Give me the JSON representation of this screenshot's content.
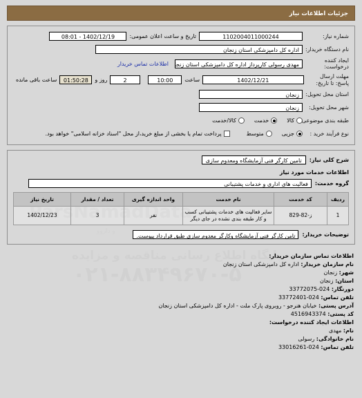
{
  "header": {
    "title": "جزئیات اطلاعات نیاز"
  },
  "form": {
    "need_number_label": "شماره نیاز:",
    "need_number_value": "1102004011000244",
    "announce_datetime_label": "تاریخ و ساعت اعلان عمومی:",
    "announce_datetime_value": "1402/12/19 - 08:01",
    "buyer_org_label": "نام دستگاه خریدار:",
    "buyer_org_value": "اداره کل دامپزشکی استان زنجان",
    "creator_label": "ایجاد کننده درخواست:",
    "creator_value": "مهدی رسولی کارپرداز اداره کل دامپزشکی استان زنجان",
    "creator_contact_link": "اطلاعات تماس خریدار",
    "deadline_label": "مهلت ارسال پاسخ: تا تاریخ:",
    "deadline_date": "1402/12/21",
    "hour_label": "ساعت",
    "deadline_time": "10:00",
    "days_value": "2",
    "days_label": "روز و",
    "countdown_value": "01:50:28",
    "countdown_label": "ساعت باقی مانده",
    "province_label": "استان محل تحویل:",
    "province_value": "زنجان",
    "city_label": "شهر محل تحویل:",
    "city_value": "زنجان",
    "classification_label": "طبقه بندی موضوعی:",
    "classification_options": [
      {
        "label": "کالا",
        "checked": false
      },
      {
        "label": "خدمت",
        "checked": true
      },
      {
        "label": "کالا/خدمت",
        "checked": false
      }
    ],
    "process_label": "نوع فرآیند خرید :",
    "process_options": [
      {
        "label": "جزیی",
        "checked": true
      },
      {
        "label": "متوسط",
        "checked": false
      }
    ],
    "treasury_checkbox_checked": false,
    "treasury_note": "پرداخت تمام یا بخشی از مبلغ خرید،از محل \"اسناد خزانه اسلامی\" خواهد بود."
  },
  "need_summary": {
    "label": "شرح کلی نیاز:",
    "value": "تامین کارگر فنی آزمایشگاه ومعدوم سازی"
  },
  "services": {
    "section_title": "اطلاعات خدمات مورد نیاز",
    "group_label": "گروه خدمت:",
    "group_value": "فعالیت های اداری و خدمات پشتیبانی",
    "table": {
      "columns": [
        "ردیف",
        "کد خدمت",
        "نام خدمت",
        "واحد اندازه گیری",
        "تعداد / مقدار",
        "تاریخ نیاز"
      ],
      "rows": [
        {
          "row": "1",
          "code": "ز-82-829",
          "name": "سایر فعالیت های خدمات پشتیبانی کسب و کار طبقه بندی نشده در جای دیگر",
          "unit": "نفر",
          "quantity": "3",
          "date": "1402/12/23"
        }
      ]
    },
    "buyer_notes_label": "توضیحات خریدار:",
    "buyer_notes_value": "تامن کارگر فنی آزمایشگاه وکارگر معدوم سازی طبق قرارداد پیوست."
  },
  "contact": {
    "org_section_title": "اطلاعات تماس سازمان خریدار:",
    "org_name_label": "نام سازمان خریدار:",
    "org_name_value": "اداره کل دامپزشکی استان زنجان",
    "city_label": "شهر:",
    "city_value": "زنجان",
    "province_label": "استان:",
    "province_value": "زنجان",
    "fax_label": "دورنگار:",
    "fax_value": "33772075-024",
    "phone_label": "تلفن تماس:",
    "phone_value": "33772401-024",
    "address_label": "آدرس پستی:",
    "address_value": "خیابان هنرجو - روبروی پارک ملت - اداره کل دامپزشکی استان زنجان",
    "postal_label": "کد پستی:",
    "postal_value": "4516943374",
    "creator_section_title": "اطلاعات ایجاد کننده درخواست:",
    "first_name_label": "نام:",
    "first_name_value": "مهدی",
    "last_name_label": "نام خانوادگی:",
    "last_name_value": "رسولی",
    "creator_phone_label": "تلفن تماس:",
    "creator_phone_value": "33016261-024"
  },
  "watermark": {
    "brand": "ParsNamadData",
    "phone": "۰۲۱-۸۸۳۴۹۶۷۰-۵",
    "tagline": "پایگاه اطلاع رسانی مناقصه و مزایده",
    "small": "و داروو"
  },
  "colors": {
    "header_bar": "#8b6c43",
    "page_bg": "#d8d8d8",
    "link": "#1b2ea8",
    "timer_bg": "#e8e2cf",
    "table_header_bg": "#c3c3c3"
  }
}
